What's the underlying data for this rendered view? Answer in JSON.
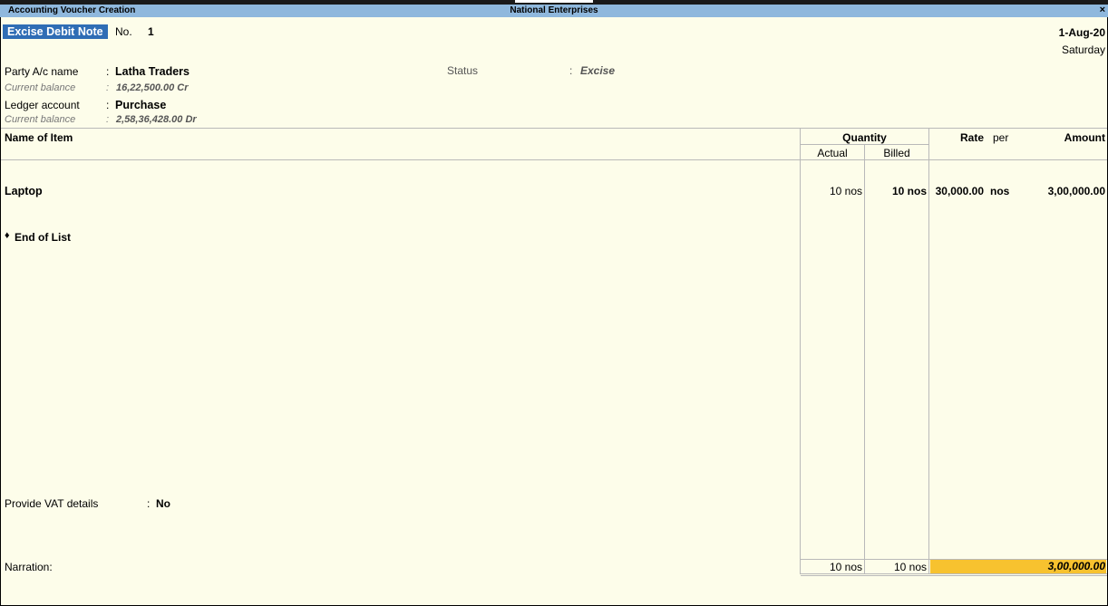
{
  "window": {
    "title": "Accounting Voucher Creation",
    "company": "National Enterprises",
    "close_glyph": "×"
  },
  "voucher": {
    "type": "Excise Debit Note",
    "no_label": "No.",
    "no_value": "1",
    "date": "1-Aug-20",
    "day": "Saturday"
  },
  "party": {
    "label": "Party A/c name",
    "sep": ":",
    "value": "Latha Traders",
    "balance_label": "Current balance",
    "balance_value": "16,22,500.00 Cr"
  },
  "status": {
    "label": "Status",
    "sep": ":",
    "value": "Excise"
  },
  "ledger": {
    "label": "Ledger account",
    "sep": ":",
    "value": "Purchase",
    "balance_label": "Current balance",
    "balance_value": "2,58,36,428.00 Dr"
  },
  "table": {
    "col_item": "Name of Item",
    "col_quantity": "Quantity",
    "col_actual": "Actual",
    "col_billed": "Billed",
    "col_rate": "Rate",
    "col_per": "per",
    "col_amount": "Amount",
    "rows": [
      {
        "item": "Laptop",
        "actual": "10 nos",
        "billed": "10 nos",
        "rate": "30,000.00",
        "per": "nos",
        "amount": "3,00,000.00"
      }
    ],
    "end_marker": "♦",
    "end_of_list": "End of List"
  },
  "vat": {
    "label": "Provide VAT details",
    "sep": ":",
    "value": "No"
  },
  "footer": {
    "narration_label": "Narration:",
    "total_actual": "10 nos",
    "total_billed": "10 nos",
    "total_amount": "3,00,000.00"
  },
  "colors": {
    "title_bar": "#8fb8dd",
    "voucher_type_bg": "#2f6db5",
    "total_highlight": "#f7c22f",
    "background": "#fdfdea"
  }
}
